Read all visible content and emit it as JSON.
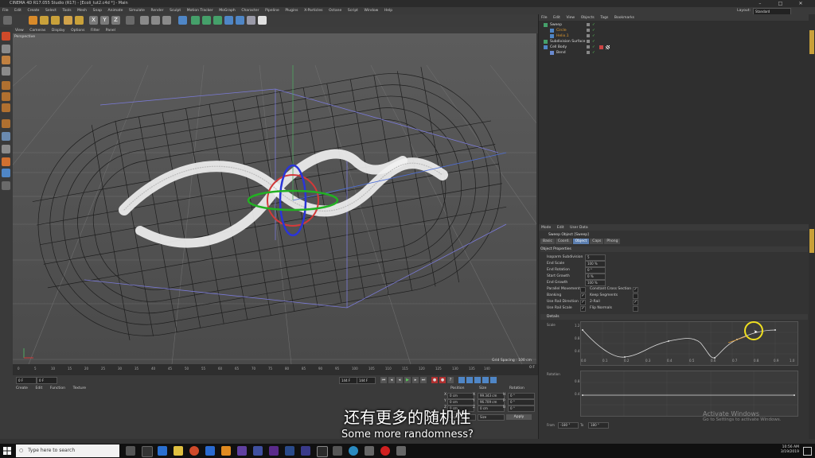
{
  "window": {
    "title": "CINEMA 4D R17.055 Studio (R17) - [Ecoli_tut2.c4d *] - Main",
    "buttons": [
      "–",
      "□",
      "✕"
    ]
  },
  "menubar": {
    "items": [
      "File",
      "Edit",
      "Create",
      "Select",
      "Tools",
      "Mesh",
      "Snap",
      "Animate",
      "Simulate",
      "Render",
      "Sculpt",
      "Motion Tracker",
      "MoGraph",
      "Character",
      "Pipeline",
      "Plugins",
      "X-Particles",
      "Octane",
      "Script",
      "Window",
      "Help"
    ],
    "layout_label": "Layout:",
    "layout_value": "Standard"
  },
  "viewport": {
    "menu": [
      "View",
      "Cameras",
      "Display",
      "Options",
      "Filter",
      "Panel"
    ],
    "label": "Perspective",
    "grid_spacing": "Grid Spacing : 100 cm"
  },
  "timeline": {
    "ticks": [
      "0",
      "5",
      "10",
      "15",
      "20",
      "25",
      "30",
      "35",
      "40",
      "45",
      "50",
      "55",
      "60",
      "65",
      "70",
      "75",
      "80",
      "85",
      "90",
      "95",
      "100",
      "105",
      "110",
      "115",
      "120",
      "125",
      "130",
      "135",
      "140"
    ],
    "frame_indicator": "0 F",
    "start_field": "0 F",
    "current_field": "0 F",
    "end_field": "144 F",
    "end_field2": "144 F"
  },
  "materials": {
    "menu": [
      "Create",
      "Edit",
      "Function",
      "Texture"
    ]
  },
  "coordinates": {
    "headers": [
      "Position",
      "Size",
      "Rotation"
    ],
    "rows": [
      {
        "pos": "0 cm",
        "size": "99.343 cm",
        "rot": "0 °",
        "pl": "X",
        "sl": "X",
        "rl": "H"
      },
      {
        "pos": "0 cm",
        "size": "96.709 cm",
        "rot": "0 °",
        "pl": "Y",
        "sl": "Y",
        "rl": "P"
      },
      {
        "pos": "0 cm",
        "size": "0 cm",
        "rot": "0 °",
        "pl": "Z",
        "sl": "Z",
        "rl": "B"
      }
    ],
    "mode1": "Object (Rel)",
    "mode2": "Size",
    "apply": "Apply"
  },
  "objects": {
    "menu": [
      "File",
      "Edit",
      "View",
      "Objects",
      "Tags",
      "Bookmarks"
    ],
    "items": [
      {
        "name": "Sweep",
        "indent": 0,
        "color": "#e0e0e0"
      },
      {
        "name": "Circle",
        "indent": 1,
        "color": "#e09a30"
      },
      {
        "name": "Helix.1",
        "indent": 1,
        "color": "#e09a30"
      },
      {
        "name": "Subdivision Surface",
        "indent": 0,
        "color": "#e0e0e0"
      },
      {
        "name": "Cell Body",
        "indent": 0,
        "color": "#e0e0e0"
      },
      {
        "name": "Bend",
        "indent": 1,
        "color": "#e0e0e0"
      }
    ]
  },
  "attributes": {
    "menu": [
      "Mode",
      "Edit",
      "User Data"
    ],
    "title": "Sweep Object [Sweep]",
    "tabs": [
      "Basic",
      "Coord.",
      "Object",
      "Caps",
      "Phong"
    ],
    "active_tab": "Object",
    "section": "Object Properties",
    "props": [
      {
        "label": "Isoparm Subdivision",
        "value": "5"
      },
      {
        "label": "End Scale",
        "value": "100 %"
      },
      {
        "label": "End Rotation",
        "value": "0 °"
      },
      {
        "label": "Start Growth",
        "value": "0 %"
      },
      {
        "label": "End Growth",
        "value": "100 %"
      }
    ],
    "checks_left": [
      {
        "label": "Parallel Movement",
        "checked": false
      },
      {
        "label": "Banking",
        "checked": true
      },
      {
        "label": "Use Rail Direction",
        "checked": true
      },
      {
        "label": "Use Rail Scale",
        "checked": true
      },
      {
        "label": "Stick UVs",
        "checked": false
      }
    ],
    "checks_right": [
      {
        "label": "Constant Cross Section",
        "checked": true
      },
      {
        "label": "Keep Segments",
        "checked": false
      },
      {
        "label": "2-Rail",
        "checked": true
      },
      {
        "label": "Flip Normals",
        "checked": false
      }
    ],
    "details": "Details",
    "scale_label": "Scale",
    "rotation_label": "Rotation",
    "scale_y_ticks": [
      "1.2",
      "0.8",
      "0.4"
    ],
    "scale_x_ticks": [
      "0.0",
      "0.1",
      "0.2",
      "0.3",
      "0.4",
      "0.5",
      "0.6",
      "0.7",
      "0.8",
      "0.9",
      "1.0"
    ],
    "rot_y_ticks": [
      "0.8",
      "0.4"
    ],
    "from_label": "From",
    "from_value": "-180 °",
    "to_label": "To",
    "to_value": "180 °"
  },
  "watermark": {
    "line1": "Activate Windows",
    "line2": "Go to Settings to activate Windows."
  },
  "subtitles": {
    "cn": "还有更多的随机性",
    "en": "Some more randomness?"
  },
  "taskbar": {
    "search_placeholder": "Type here to search",
    "time": "10:56 AM",
    "date": "3/19/2019"
  },
  "colors": {
    "accent": "#5c7fb0",
    "viewport_bg": "#5a5a5a",
    "object_orange": "#e09a30"
  }
}
